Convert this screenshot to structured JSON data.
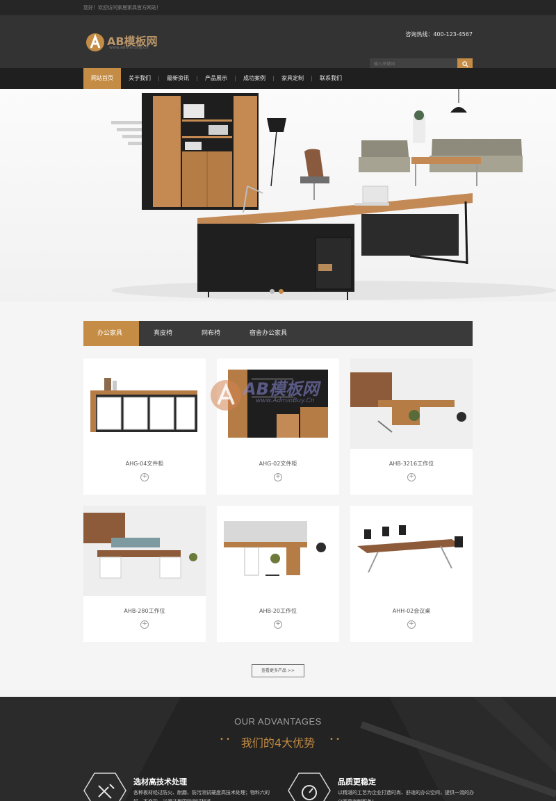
{
  "top_strip": {
    "welcome": "您好！欢迎访问家居家具官方网站！"
  },
  "header": {
    "logo_text": "AB模板网",
    "logo_sub": "www.admin.buy.cn",
    "hotline": "咨询热线：400-123-4567",
    "search_placeholder": "输入关键词",
    "accent_color": "#c48c44"
  },
  "nav": {
    "items": [
      {
        "label": "网站首页",
        "active": true
      },
      {
        "label": "关于我们"
      },
      {
        "label": "最新资讯"
      },
      {
        "label": "产品展示"
      },
      {
        "label": "成功案例"
      },
      {
        "label": "家具定制"
      },
      {
        "label": "联系我们"
      }
    ]
  },
  "banner": {
    "slide_count": 2,
    "active_slide": 1
  },
  "tabs": [
    {
      "label": "办公家具",
      "active": true
    },
    {
      "label": "真皮椅"
    },
    {
      "label": "网布椅"
    },
    {
      "label": "宿舍办公家具"
    }
  ],
  "products": [
    {
      "title": "AHG-04文件柜"
    },
    {
      "title": "AHG-02文件柜"
    },
    {
      "title": "AHB-3216工作位"
    },
    {
      "title": "AHB-280工作位"
    },
    {
      "title": "AHB-20工作位"
    },
    {
      "title": "AHH-02会议桌"
    }
  ],
  "more_button": "查看更多产品 >>",
  "watermark": {
    "text": "AB模板网",
    "sub": "www.AdminBuy.Cn"
  },
  "advantages": {
    "en_title": "OUR ADVANTAGES",
    "cn_title": "我们的4大优势",
    "items": [
      {
        "icon": "tools-icon",
        "title": "选材高技术处理",
        "desc": "各种板材经过防火、耐磨、防污测试硬度高技术处理；物料六的好，不变形，光滑达到国际测试标准"
      },
      {
        "icon": "gauge-icon",
        "title": "品质更稳定",
        "desc": "以精湛的工艺为企业打造时尚、舒适的办公空间，提供一流的办公家具定制服务！"
      }
    ]
  }
}
